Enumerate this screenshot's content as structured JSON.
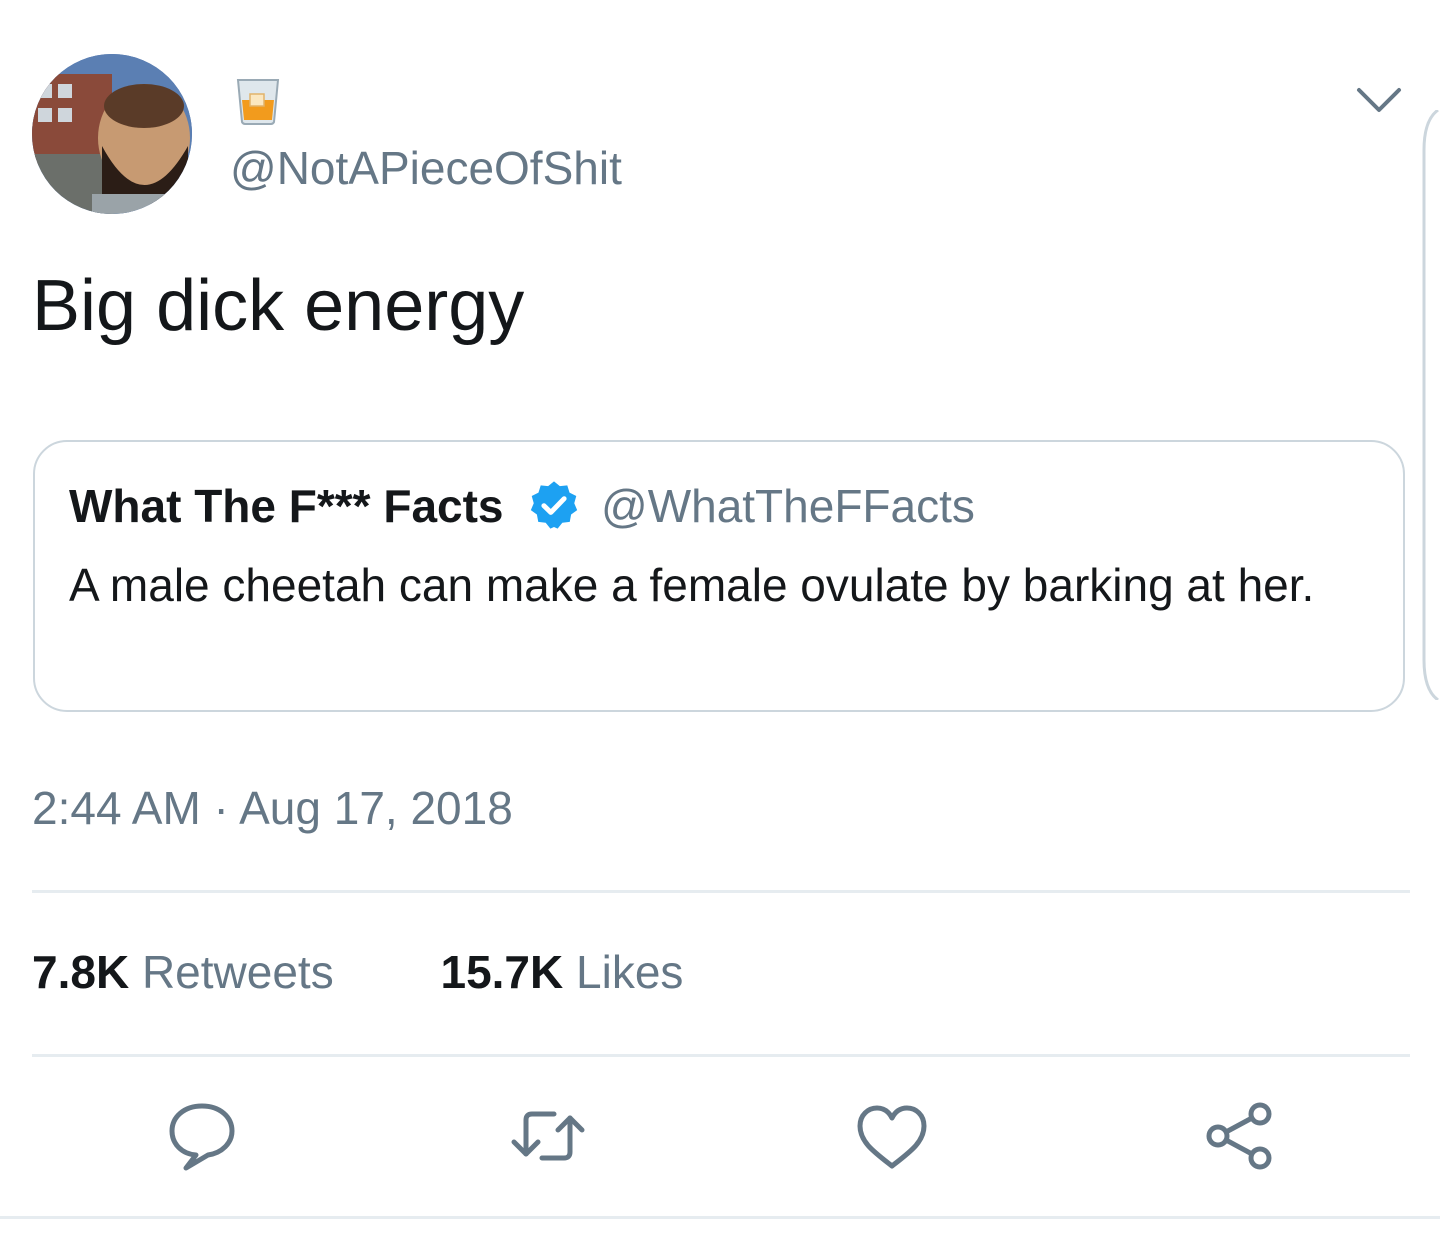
{
  "tweet": {
    "handle": "@NotAPieceOfShit",
    "name_emoji": "tumbler-glass-emoji",
    "text": "Big dick energy",
    "timestamp": "2:44 AM · Aug 17, 2018"
  },
  "quoted": {
    "name": "What The F*** Facts",
    "verified": true,
    "handle": "@WhatTheFFacts",
    "text": "A male cheetah can make a female ovulate by barking at her."
  },
  "stats": {
    "retweets_count": "7.8K",
    "retweets_label": "Retweets",
    "likes_count": "15.7K",
    "likes_label": "Likes"
  },
  "actions": [
    "reply-icon",
    "retweet-icon",
    "like-icon",
    "share-icon"
  ],
  "colors": {
    "text": "#14171a",
    "secondary": "#657786",
    "border": "#ccd6dd",
    "divider": "#e6ecf0",
    "verified": "#1da1f2"
  }
}
